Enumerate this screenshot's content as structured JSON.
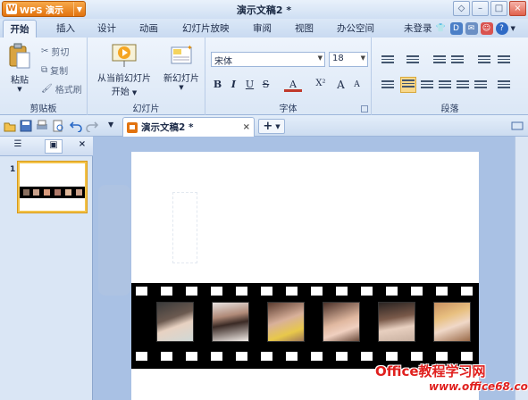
{
  "app": {
    "logo_label": "WPS 演示",
    "doc_title": "演示文稿2 *"
  },
  "tabs": [
    "开始",
    "插入",
    "设计",
    "动画",
    "幻灯片放映",
    "审阅",
    "视图",
    "办公空间"
  ],
  "user_status": "未登录",
  "ribbon": {
    "clipboard": {
      "paste": "粘贴",
      "cut": "剪切",
      "copy": "复制",
      "format_painter": "格式刷",
      "label": "剪贴板"
    },
    "slides": {
      "from_current_line1": "从当前幻灯片",
      "from_current_line2": "开始",
      "new_slide": "新幻灯片",
      "label": "幻灯片"
    },
    "font": {
      "font_name": "宋体",
      "font_size": "18",
      "label": "字体",
      "bold": "B",
      "italic": "I",
      "underline": "U",
      "strike": "S",
      "color": "A",
      "superscript": "X²",
      "grow": "A",
      "shrink": "A"
    },
    "paragraph": {
      "label": "段落"
    }
  },
  "doc_tab": {
    "label": "演示文稿2 *",
    "close": "×",
    "add": "+"
  },
  "side_panel": {
    "close": "×",
    "slide_number": "1"
  },
  "watermark": {
    "line1": "Office教程学习网",
    "line2": "www.office68.com"
  },
  "colors": {
    "accent_orange": "#e2730f",
    "ribbon_bg": "#eef4fc",
    "canvas_bg": "#a9c1e4",
    "thumb_border": "#f3c34a"
  }
}
